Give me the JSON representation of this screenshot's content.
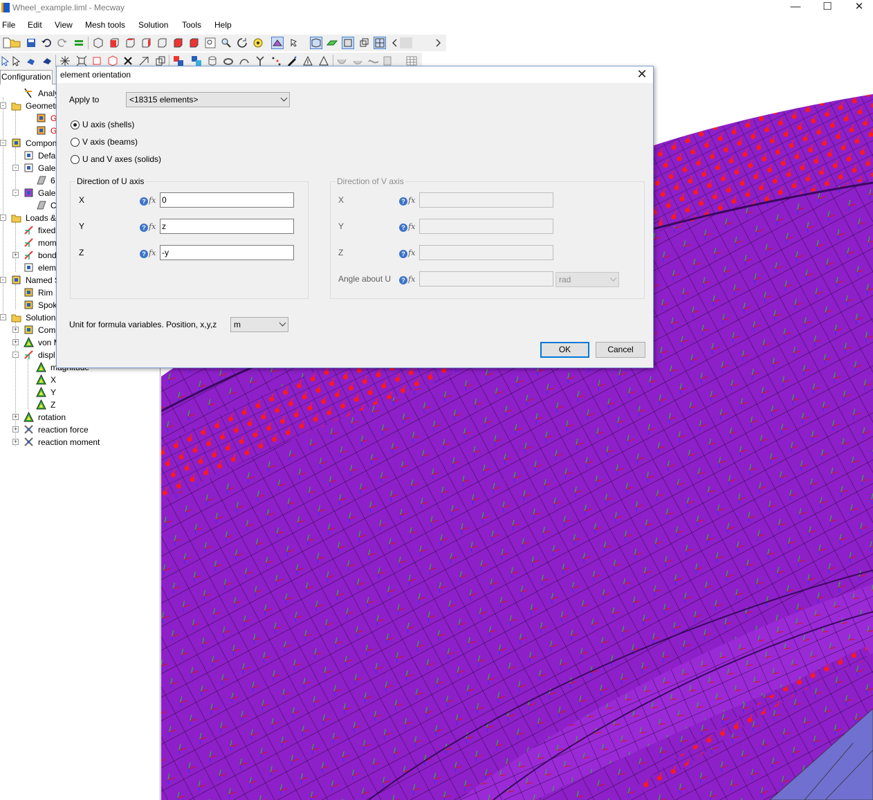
{
  "window": {
    "title": "Wheel_example.liml - Mecway",
    "controls": {
      "minimize": "—",
      "maximize": "☐",
      "close": "✕"
    }
  },
  "menu": [
    "File",
    "Edit",
    "View",
    "Mesh tools",
    "Solution",
    "Tools",
    "Help"
  ],
  "left_panel": {
    "tab_label": "Configuration",
    "tree": [
      {
        "label": "Analysis",
        "icon": "analysis-icon"
      },
      {
        "label": "Geometr",
        "icon": "folder-icon"
      },
      {
        "label": "Gales",
        "icon": "geometry-icon",
        "red": true
      },
      {
        "label": "Gales",
        "icon": "geometry-icon",
        "red": true
      },
      {
        "label": "Compon",
        "icon": "components-icon"
      },
      {
        "label": "Defa",
        "icon": "component-icon"
      },
      {
        "label": "Gales",
        "icon": "component-icon"
      },
      {
        "label": "6",
        "icon": "shell-icon"
      },
      {
        "label": "Gales",
        "icon": "component-purple-icon"
      },
      {
        "label": "C",
        "icon": "shell-icon"
      },
      {
        "label": "Loads &",
        "icon": "loads-folder-icon"
      },
      {
        "label": "fixed",
        "icon": "constraint-icon"
      },
      {
        "label": "mom",
        "icon": "constraint-icon"
      },
      {
        "label": "bond",
        "icon": "constraint-icon"
      },
      {
        "label": "elem",
        "icon": "orientation-icon"
      },
      {
        "label": "Named S",
        "icon": "named-selection-icon"
      },
      {
        "label": "Rim",
        "icon": "selection-icon"
      },
      {
        "label": "Spok",
        "icon": "selection-icon"
      },
      {
        "label": "Solution",
        "icon": "solution-icon"
      },
      {
        "label": "Com",
        "icon": "components-icon"
      },
      {
        "label": "von M",
        "icon": "result-icon"
      },
      {
        "label": "displ",
        "icon": "displacement-icon"
      },
      {
        "label": "magnitude",
        "icon": "result-icon"
      },
      {
        "label": "X",
        "icon": "result-icon"
      },
      {
        "label": "Y",
        "icon": "result-icon"
      },
      {
        "label": "Z",
        "icon": "result-icon"
      },
      {
        "label": "rotation",
        "icon": "result-icon"
      },
      {
        "label": "reaction force",
        "icon": "reaction-icon"
      },
      {
        "label": "reaction moment",
        "icon": "reaction-icon"
      }
    ]
  },
  "dialog": {
    "title": "element orientation",
    "close_glyph": "✕",
    "apply_to_label": "Apply to",
    "apply_to_value": "<18315 elements>",
    "radios": [
      {
        "label": "U axis (shells)",
        "checked": true
      },
      {
        "label": "V axis (beams)",
        "checked": false
      },
      {
        "label": "U and V axes (solids)",
        "checked": false
      }
    ],
    "u_group": {
      "title": "Direction of U axis",
      "rows": [
        {
          "label": "X",
          "value": "0"
        },
        {
          "label": "Y",
          "value": "z"
        },
        {
          "label": "Z",
          "value": "-y"
        }
      ]
    },
    "v_group": {
      "title": "Direction of V axis",
      "rows": [
        {
          "label": "X",
          "value": ""
        },
        {
          "label": "Y",
          "value": ""
        },
        {
          "label": "Z",
          "value": ""
        }
      ],
      "angle_label": "Angle about U",
      "angle_value": "",
      "angle_unit": "rad"
    },
    "help_glyph": "?",
    "fx_glyph": "fx",
    "unit_label": "Unit for formula variables. Position, x,y,z",
    "unit_value": "m",
    "ok_label": "OK",
    "cancel_label": "Cancel"
  },
  "colors": {
    "mesh_purple": "#8a1fc4",
    "mesh_dark": "#5e0f91",
    "constraint_red": "#ff1a1a",
    "accent_blue": "#0078d7"
  }
}
